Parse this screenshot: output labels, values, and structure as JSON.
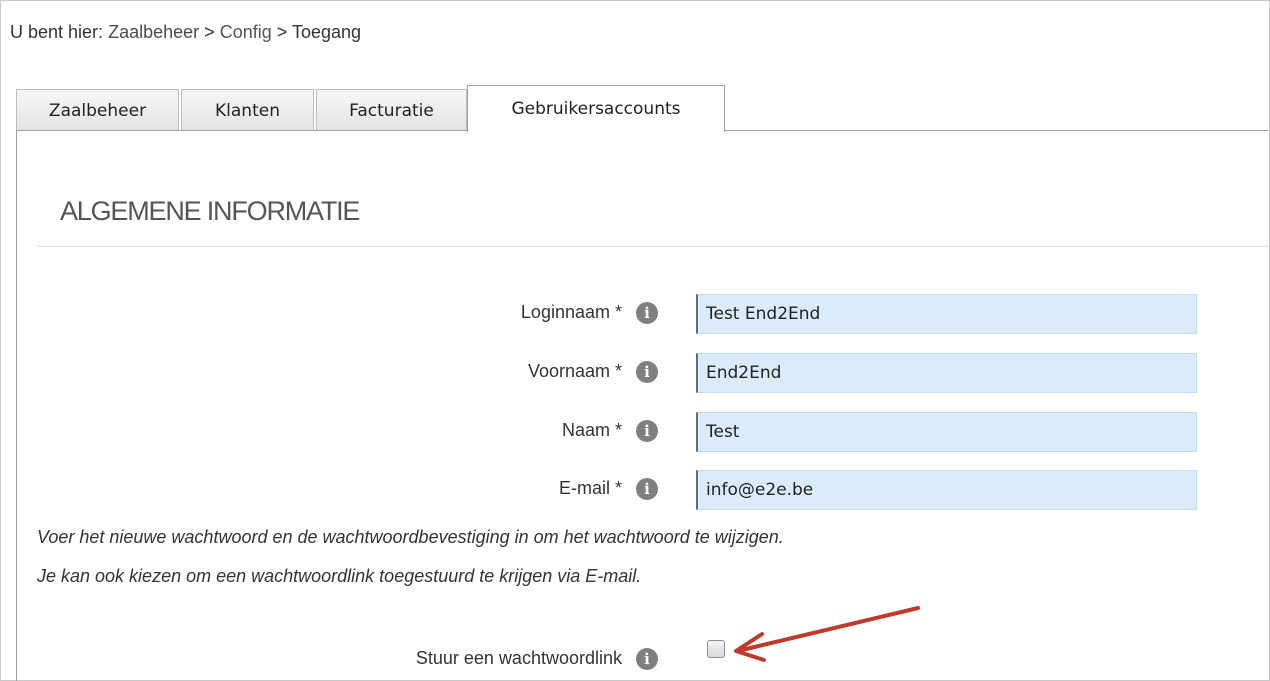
{
  "breadcrumb": {
    "prefix": "U bent hier:",
    "items": [
      "Zaalbeheer",
      "Config",
      "Toegang"
    ],
    "separator": ">"
  },
  "tabs": [
    {
      "label": "Zaalbeheer",
      "active": false
    },
    {
      "label": "Klanten",
      "active": false
    },
    {
      "label": "Facturatie",
      "active": false
    },
    {
      "label": "Gebruikersaccounts",
      "active": true
    }
  ],
  "section": {
    "title": "ALGEMENE INFORMATIE"
  },
  "form": {
    "fields": [
      {
        "label": "Loginnaam *",
        "value": "Test End2End",
        "icon": "info-icon"
      },
      {
        "label": "Voornaam *",
        "value": "End2End",
        "icon": "info-icon"
      },
      {
        "label": "Naam *",
        "value": "Test",
        "icon": "info-icon"
      },
      {
        "label": "E-mail *",
        "value": "info@e2e.be",
        "icon": "info-icon"
      }
    ],
    "notes": [
      "Voer het nieuwe wachtwoord en de wachtwoordbevestiging in om het wachtwoord te wijzigen.",
      "Je kan ook kiezen om een wachtwoordlink toegestuurd te krijgen via E-mail."
    ],
    "password_link": {
      "label": "Stuur een wachtwoordlink",
      "checked": false,
      "icon": "info-icon"
    }
  },
  "info_glyph": "i",
  "colors": {
    "field_bg": "#dcebfb",
    "annotation_arrow": "#c0392b"
  }
}
